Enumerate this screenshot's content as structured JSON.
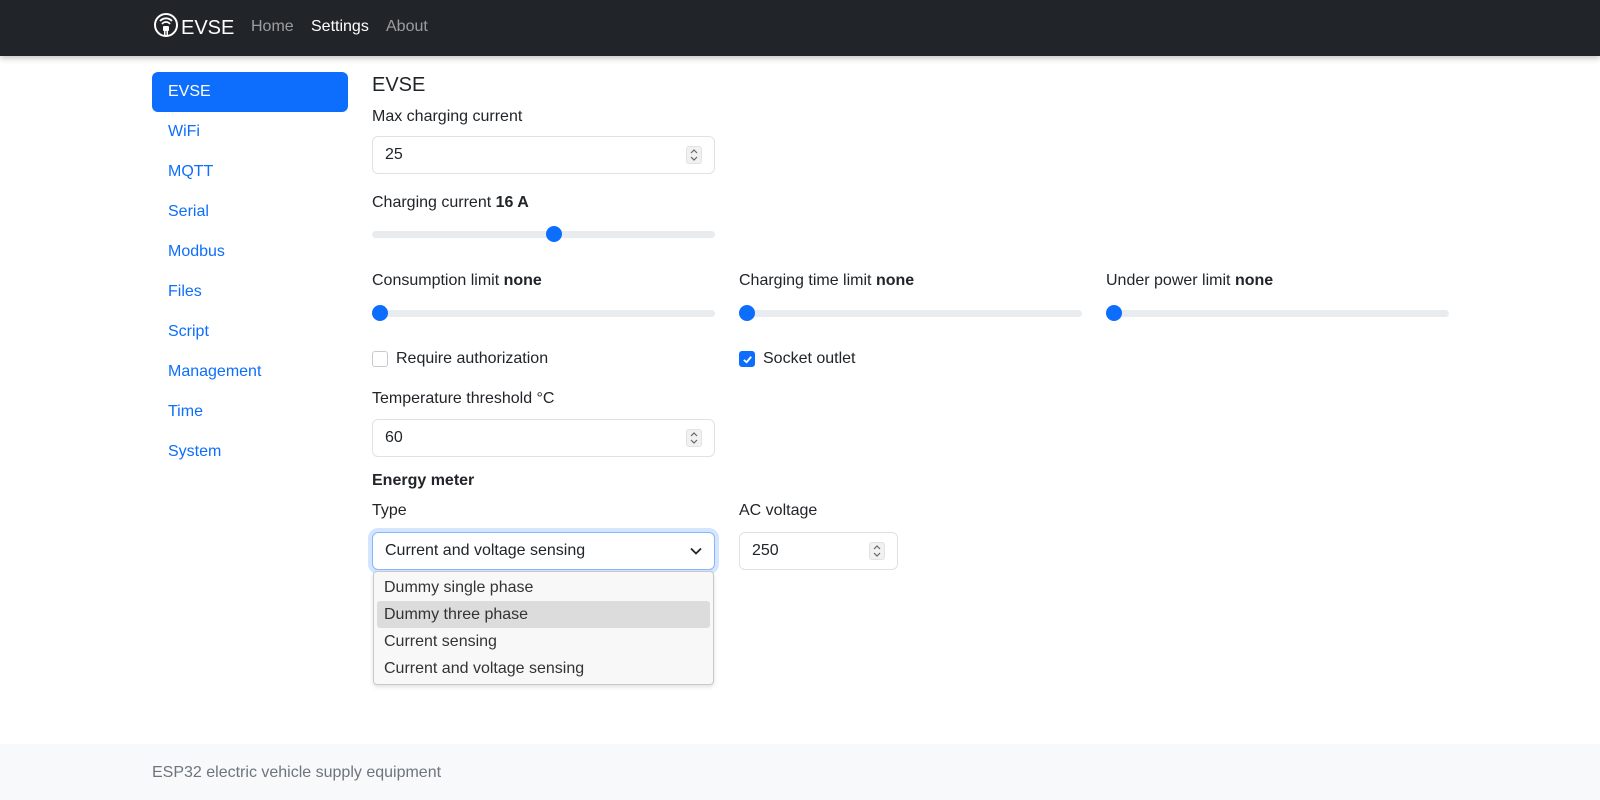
{
  "navbar": {
    "brand": "EVSE",
    "brand_icon": "wireless-plug-icon",
    "links": [
      {
        "label": "Home",
        "active": false
      },
      {
        "label": "Settings",
        "active": true
      },
      {
        "label": "About",
        "active": false
      }
    ]
  },
  "sidebar": {
    "items": [
      {
        "label": "EVSE",
        "active": true
      },
      {
        "label": "WiFi"
      },
      {
        "label": "MQTT"
      },
      {
        "label": "Serial"
      },
      {
        "label": "Modbus"
      },
      {
        "label": "Files"
      },
      {
        "label": "Script"
      },
      {
        "label": "Management"
      },
      {
        "label": "Time"
      },
      {
        "label": "System"
      }
    ]
  },
  "evse": {
    "title": "EVSE",
    "max_current": {
      "label": "Max charging current",
      "value": "25"
    },
    "charging_current": {
      "label": "Charging current",
      "value": "16 A",
      "slider_fraction": 0.53
    },
    "consumption_limit": {
      "label": "Consumption limit",
      "value": "none",
      "slider_fraction": 0.0
    },
    "charging_time_limit": {
      "label": "Charging time limit",
      "value": "none",
      "slider_fraction": 0.0
    },
    "under_power_limit": {
      "label": "Under power limit",
      "value": "none",
      "slider_fraction": 0.0
    },
    "require_auth": {
      "label": "Require authorization",
      "checked": false
    },
    "socket_outlet": {
      "label": "Socket outlet",
      "checked": true
    },
    "temp_threshold": {
      "label": "Temperature threshold °C",
      "value": "60"
    },
    "energy_meter": {
      "heading": "Energy meter",
      "type_label": "Type",
      "type_value": "Current and voltage sensing",
      "options": [
        "Dummy single phase",
        "Dummy three phase",
        "Current sensing",
        "Current and voltage sensing"
      ],
      "highlighted_option": "Dummy three phase",
      "ac_voltage_label": "AC voltage",
      "ac_voltage_value": "250"
    }
  },
  "footer": {
    "text": "ESP32 electric vehicle supply equipment"
  },
  "colors": {
    "accent": "#0d6efd",
    "navbar": "#212529",
    "footer": "#f8f9fa"
  }
}
